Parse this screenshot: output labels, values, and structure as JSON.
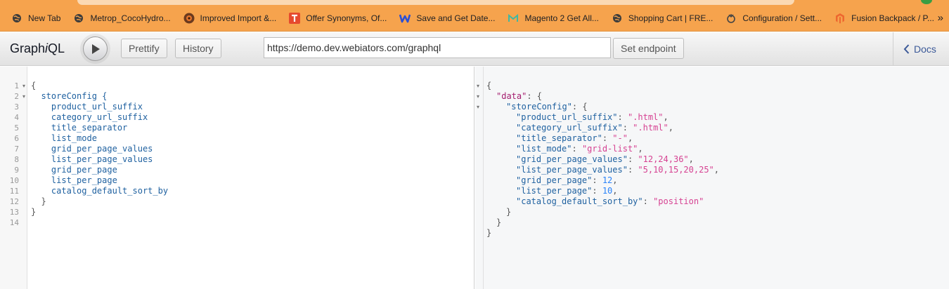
{
  "bookmarks": [
    {
      "label": "New Tab",
      "icon": "globe-icon"
    },
    {
      "label": "Metrop_CocoHydro...",
      "icon": "globe-icon"
    },
    {
      "label": "Improved Import &...",
      "icon": "improved-import-icon"
    },
    {
      "label": "Offer Synonyms, Of...",
      "icon": "offer-synonyms-icon"
    },
    {
      "label": "Save and Get Date...",
      "icon": "webiators-w-icon"
    },
    {
      "label": "Magento 2 Get All...",
      "icon": "magento-m-icon"
    },
    {
      "label": "Shopping Cart | FRE...",
      "icon": "globe-icon"
    },
    {
      "label": "Configuration / Sett...",
      "icon": "configuration-icon"
    },
    {
      "label": "Fusion Backpack / P...",
      "icon": "magento-logo-icon"
    }
  ],
  "bookmarks_more": "»",
  "toolbar": {
    "title_prefix": "Graph",
    "title_italic": "i",
    "title_suffix": "QL",
    "prettify_label": "Prettify",
    "history_label": "History",
    "endpoint_value": "https://demo.dev.webiators.com/graphql",
    "set_endpoint_label": "Set endpoint",
    "docs_label": "Docs"
  },
  "query_lines": [
    "{",
    "  storeConfig {",
    "    product_url_suffix",
    "    category_url_suffix",
    "    title_separator",
    "    list_mode",
    "    grid_per_page_values",
    "    list_per_page_values",
    "    grid_per_page",
    "    list_per_page",
    "    catalog_default_sort_by",
    "  }",
    "}",
    ""
  ],
  "line_numbers": [
    "1",
    "2",
    "3",
    "4",
    "5",
    "6",
    "7",
    "8",
    "9",
    "10",
    "11",
    "12",
    "13",
    "14"
  ],
  "result": {
    "data_key": "\"data\"",
    "store_key": "\"storeConfig\"",
    "fields": [
      {
        "key": "\"product_url_suffix\"",
        "value": "\".html\"",
        "type": "string"
      },
      {
        "key": "\"category_url_suffix\"",
        "value": "\".html\"",
        "type": "string"
      },
      {
        "key": "\"title_separator\"",
        "value": "\"-\"",
        "type": "string"
      },
      {
        "key": "\"list_mode\"",
        "value": "\"grid-list\"",
        "type": "string"
      },
      {
        "key": "\"grid_per_page_values\"",
        "value": "\"12,24,36\"",
        "type": "string"
      },
      {
        "key": "\"list_per_page_values\"",
        "value": "\"5,10,15,20,25\"",
        "type": "string"
      },
      {
        "key": "\"grid_per_page\"",
        "value": "12",
        "type": "number"
      },
      {
        "key": "\"list_per_page\"",
        "value": "10",
        "type": "number"
      },
      {
        "key": "\"catalog_default_sort_by\"",
        "value": "\"position\"",
        "type": "string"
      }
    ]
  },
  "colors": {
    "browser_accent": "#f6a34d",
    "field_blue": "#1f61a0",
    "string_pink": "#d64292",
    "number_blue": "#2882f9",
    "docs_link": "#3b5998"
  }
}
